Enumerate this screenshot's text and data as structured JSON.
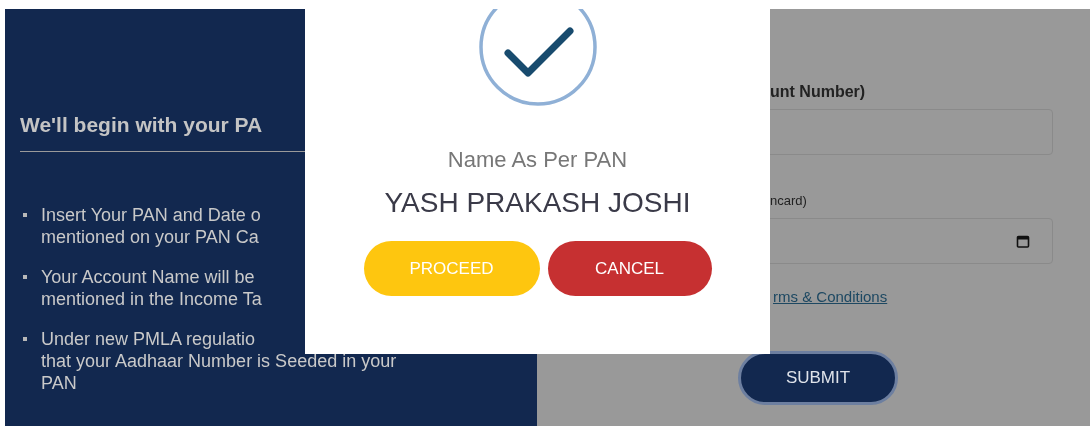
{
  "left_panel": {
    "heading": "We'll begin with your PA",
    "bullets": [
      {
        "lines": [
          "Insert Your PAN and Date o",
          "mentioned on your PAN Ca"
        ]
      },
      {
        "lines": [
          "Your Account Name will be",
          "mentioned in the Income Ta"
        ]
      },
      {
        "lines": [
          "Under new PMLA regulatio",
          "that your Aadhaar Number is Seeded in your",
          "PAN"
        ]
      }
    ]
  },
  "right_panel": {
    "pan_label": "unt Number)",
    "dob_label": "ncard)",
    "terms_link": "rms & Conditions",
    "submit_button": "SUBMIT"
  },
  "modal": {
    "title": "Name As Per PAN",
    "name": "YASH PRAKASH JOSHI",
    "buttons": [
      {
        "label": "PROCEED",
        "kind": "primary"
      },
      {
        "label": "CANCEL",
        "kind": "cancel"
      }
    ]
  }
}
